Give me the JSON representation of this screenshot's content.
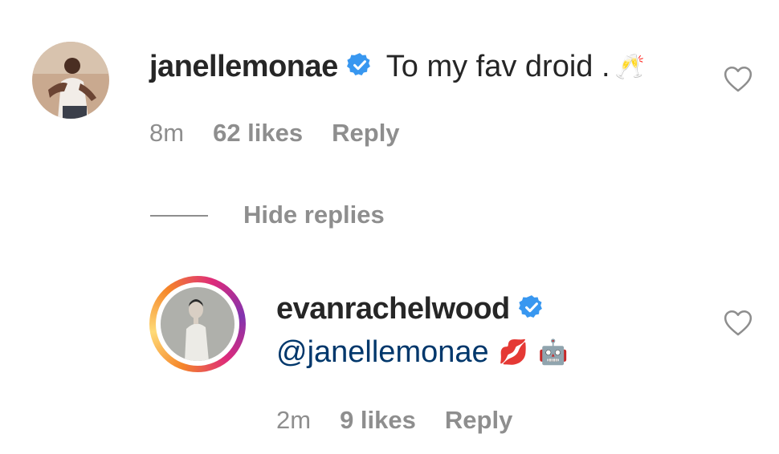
{
  "comment": {
    "username": "janellemonae",
    "text": "To my fav droid . ",
    "emoji": "🥂",
    "time": "8m",
    "likes": "62 likes",
    "reply_label": "Reply"
  },
  "thread": {
    "toggle_label": "Hide replies"
  },
  "reply": {
    "username": "evanrachelwood",
    "mention": "@janellemonae",
    "emoji_kiss": "💋",
    "emoji_robot": "🤖",
    "time": "2m",
    "likes": "9 likes",
    "reply_label": "Reply"
  },
  "colors": {
    "verified": "#3897f0",
    "meta": "#8e8e8e",
    "mention": "#00376b",
    "story_ring_start": "#f58529",
    "story_ring_end": "#dd2a7b"
  },
  "icons": {
    "verified": "verified-badge-icon",
    "like": "heart-outline-icon"
  }
}
